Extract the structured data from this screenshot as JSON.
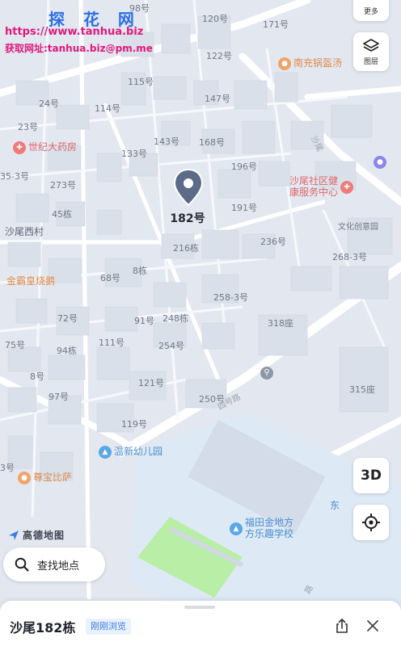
{
  "watermark": {
    "title": "探 花 网",
    "url": "https://www.tanhua.biz",
    "mail": "获取网址:tanhua.biz@pm.me"
  },
  "controls": {
    "more_label": "更多",
    "layers_label": "图层",
    "btn_3d_label": "3D"
  },
  "pin": {
    "label": "182号"
  },
  "building_labels": [
    "98号",
    "120号",
    "171号",
    "122号",
    "115号",
    "147号",
    "24号",
    "114号",
    "23号",
    "143号",
    "168号",
    "133号",
    "196号",
    "35-3号",
    "273号",
    "191号",
    "45栋",
    "236号",
    "216栋",
    "8栋",
    "68号",
    "268-3号",
    "258-3号",
    "91号",
    "248栋",
    "72号",
    "318座",
    "75号",
    "94栋",
    "111号",
    "254号",
    "8号",
    "121号",
    "315座",
    "97号",
    "250号",
    "119号",
    "3号"
  ],
  "pois": [
    {
      "name": "世纪大药房",
      "kind": "red"
    },
    {
      "name": "沙尾社区健\n康服务中心",
      "kind": "red"
    },
    {
      "name": "南充锅盔汤",
      "kind": "orange"
    },
    {
      "name": "金霸皇烧鹅",
      "kind": "orange"
    },
    {
      "name": "尊宝比萨",
      "kind": "orange"
    },
    {
      "name": "温新幼儿园",
      "kind": "blue"
    },
    {
      "name": "福田金地方\n方乐趣学校",
      "kind": "blue"
    },
    {
      "name": "东",
      "kind": "blue"
    }
  ],
  "area_labels": {
    "village": "沙尾西村",
    "garden": "文化创意园"
  },
  "road_labels": [
    "沙尾",
    "四号路",
    "路"
  ],
  "logo": {
    "text": "高德地图"
  },
  "search": {
    "placeholder": "查找地点"
  },
  "sheet": {
    "title": "沙尾182栋",
    "badge": "刚刚浏览"
  },
  "colors": {
    "map_bg": "#eef1f6",
    "road": "#ffffff",
    "building": "#dde3ec",
    "accent": "#2d6fe6",
    "watermark": "#e0187a",
    "pin": "#5b6b88"
  }
}
